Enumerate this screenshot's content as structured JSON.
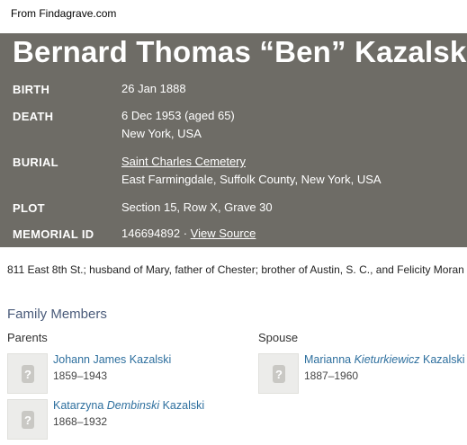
{
  "source_caption": "From Findagrave.com",
  "person": {
    "name": "Bernard Thomas “Ben” Kazalski"
  },
  "facts": {
    "birth": {
      "label": "BIRTH",
      "value": "26 Jan 1888"
    },
    "death": {
      "label": "DEATH",
      "value": "6 Dec 1953 (aged 65)",
      "place": "New York, USA"
    },
    "burial": {
      "label": "BURIAL",
      "cemetery": "Saint Charles Cemetery",
      "place": "East Farmingdale, Suffolk County, New York, USA"
    },
    "plot": {
      "label": "PLOT",
      "value": "Section 15, Row X, Grave 30"
    },
    "memorial": {
      "label": "MEMORIAL ID",
      "id": "146694892",
      "separator": " · ",
      "link": "View Source"
    }
  },
  "bio": "811 East 8th St.; husband of Mary, father of Chester; brother of Austin, S. C., and Felicity Moran",
  "family": {
    "title": "Family Members",
    "parents_label": "Parents",
    "spouse_label": "Spouse",
    "parents": [
      {
        "first": "Johann James ",
        "maiden": "",
        "last": "Kazalski",
        "dates": "1859–1943"
      },
      {
        "first": "Katarzyna ",
        "maiden": "Dembinski",
        "last": " Kazalski",
        "dates": "1868–1932"
      }
    ],
    "spouse": [
      {
        "first": "Marianna ",
        "maiden": "Kieturkiewicz",
        "last": " Kazalski",
        "dates": "1887–1960"
      }
    ]
  },
  "icons": {
    "photo_placeholder": "question-mark-photo-icon"
  },
  "colors": {
    "header_bg": "#6e6c66",
    "link_blue": "#2d6f9e",
    "section_title": "#4a5b7a"
  }
}
